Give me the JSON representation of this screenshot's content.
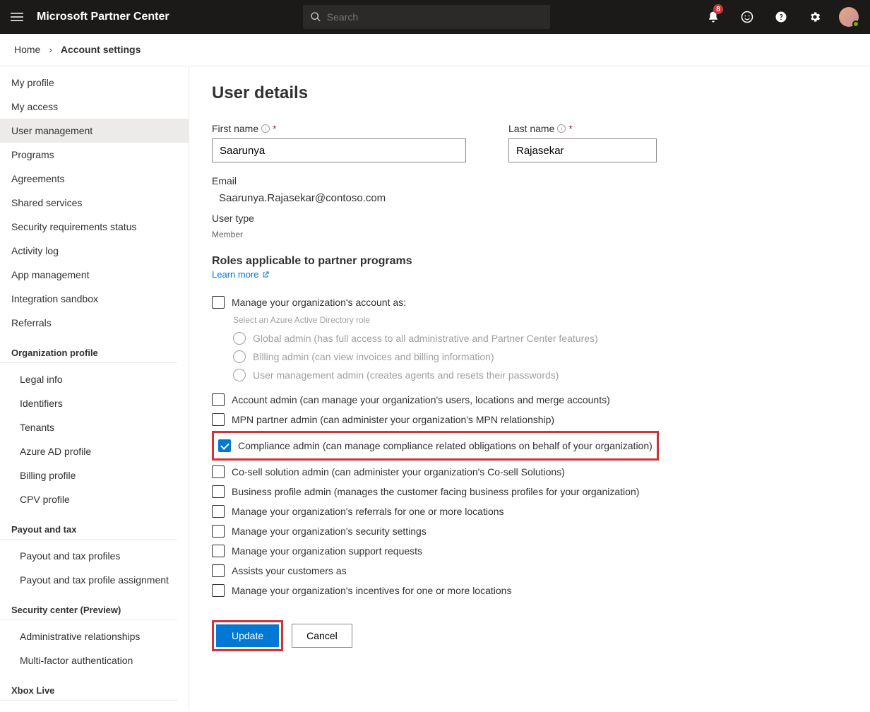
{
  "header": {
    "brand": "Microsoft Partner Center",
    "search_placeholder": "Search",
    "notification_count": "8"
  },
  "breadcrumb": {
    "home": "Home",
    "current": "Account settings"
  },
  "sidebar": {
    "items": [
      "My profile",
      "My access",
      "User management",
      "Programs",
      "Agreements",
      "Shared services",
      "Security requirements status",
      "Activity log",
      "App management",
      "Integration sandbox",
      "Referrals"
    ],
    "groups": [
      {
        "title": "Organization profile",
        "subs": [
          "Legal info",
          "Identifiers",
          "Tenants",
          "Azure AD profile",
          "Billing profile",
          "CPV profile"
        ]
      },
      {
        "title": "Payout and tax",
        "subs": [
          "Payout and tax profiles",
          "Payout and tax profile assignment"
        ]
      },
      {
        "title": "Security center (Preview)",
        "subs": [
          "Administrative relationships",
          "Multi-factor authentication"
        ]
      },
      {
        "title": "Xbox Live",
        "subs": []
      }
    ]
  },
  "main": {
    "title": "User details",
    "first_name_label": "First name",
    "first_name_value": "Saarunya",
    "last_name_label": "Last name",
    "last_name_value": "Rajasekar",
    "email_label": "Email",
    "email_value": "Saarunya.Rajasekar@contoso.com",
    "user_type_label": "User type",
    "user_type_value": "Member",
    "roles_heading": "Roles applicable to partner programs",
    "learn_more": "Learn more",
    "manage_as_label": "Manage your organization's account as:",
    "aad_legend": "Select an Azure Active Directory role",
    "aad_roles": [
      "Global admin (has full access to all administrative and Partner Center features)",
      "Billing admin (can view invoices and billing information)",
      "User management admin (creates agents and resets their passwords)"
    ],
    "roles": [
      {
        "label": "Account admin (can manage your organization's users, locations and merge accounts)",
        "checked": false,
        "highlight": false
      },
      {
        "label": "MPN partner admin (can administer your organization's MPN relationship)",
        "checked": false,
        "highlight": false
      },
      {
        "label": "Compliance admin (can manage compliance related obligations on behalf of your organization)",
        "checked": true,
        "highlight": true
      },
      {
        "label": "Co-sell solution admin (can administer your organization's Co-sell Solutions)",
        "checked": false,
        "highlight": false
      },
      {
        "label": "Business profile admin (manages the customer facing business profiles for your organization)",
        "checked": false,
        "highlight": false
      },
      {
        "label": "Manage your organization's referrals for one or more locations",
        "checked": false,
        "highlight": false
      },
      {
        "label": "Manage your organization's security settings",
        "checked": false,
        "highlight": false
      },
      {
        "label": "Manage your organization support requests",
        "checked": false,
        "highlight": false
      },
      {
        "label": "Assists your customers as",
        "checked": false,
        "highlight": false
      },
      {
        "label": "Manage your organization's incentives for one or more locations",
        "checked": false,
        "highlight": false
      }
    ],
    "update_btn": "Update",
    "cancel_btn": "Cancel"
  }
}
